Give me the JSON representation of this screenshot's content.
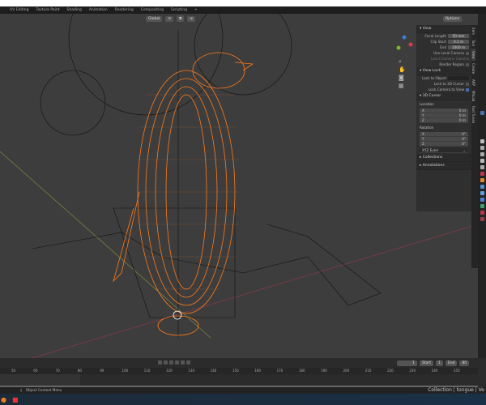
{
  "workspaces": [
    "UV Editing",
    "Texture Paint",
    "Shading",
    "Animation",
    "Rendering",
    "Compositing",
    "Scripting",
    "+"
  ],
  "header": {
    "orientation": "Global",
    "options": "Options"
  },
  "npanel": {
    "view": {
      "title": "View",
      "focal_length_label": "Focal Length",
      "focal_length": "50 mm",
      "clip_start_label": "Clip Start",
      "clip_start": "0.1 m",
      "end_label": "End",
      "end": "1000 m",
      "use_local_camera": "Use Local Camera",
      "local_camera_label": "Local Camera",
      "local_camera": "Camera",
      "render_region": "Render Region"
    },
    "view_lock": {
      "title": "View Lock",
      "lock_to_object": "Lock to Object",
      "lock_3d_cursor": "Lock to 3D Cursor",
      "lock_camera": "Lock Camera to View",
      "lock_camera_checked": true
    },
    "cursor": {
      "title": "3D Cursor",
      "location": "Location",
      "loc": [
        {
          "axis": "X",
          "value": "0 m"
        },
        {
          "axis": "Y",
          "value": "0 m"
        },
        {
          "axis": "Z",
          "value": "0 m"
        }
      ],
      "rotation": "Rotation",
      "rot": [
        {
          "axis": "X",
          "value": "0°"
        },
        {
          "axis": "Y",
          "value": "0°"
        },
        {
          "axis": "Z",
          "value": "0°"
        }
      ],
      "mode": "XYZ Euler"
    },
    "collections": "Collections",
    "annotations": "Annotations"
  },
  "tabs": [
    "Item",
    "Tool",
    "View",
    "Create",
    "ARP",
    "MhLab",
    "Fast Tuned"
  ],
  "timeline": {
    "current": "1",
    "start_label": "Start",
    "start": "1",
    "end_label": "End",
    "end": "80",
    "ticks": [
      "50",
      "60",
      "70",
      "80",
      "90",
      "100",
      "110",
      "120",
      "130",
      "140",
      "150",
      "160",
      "170",
      "180",
      "190",
      "200",
      "210",
      "220",
      "230",
      "240",
      "250"
    ]
  },
  "status": {
    "left": "Object Context Menu",
    "right": "Collection | tongue | Ve"
  },
  "colors": {
    "accent": "#4772b3",
    "select": "#ff7a1a"
  }
}
